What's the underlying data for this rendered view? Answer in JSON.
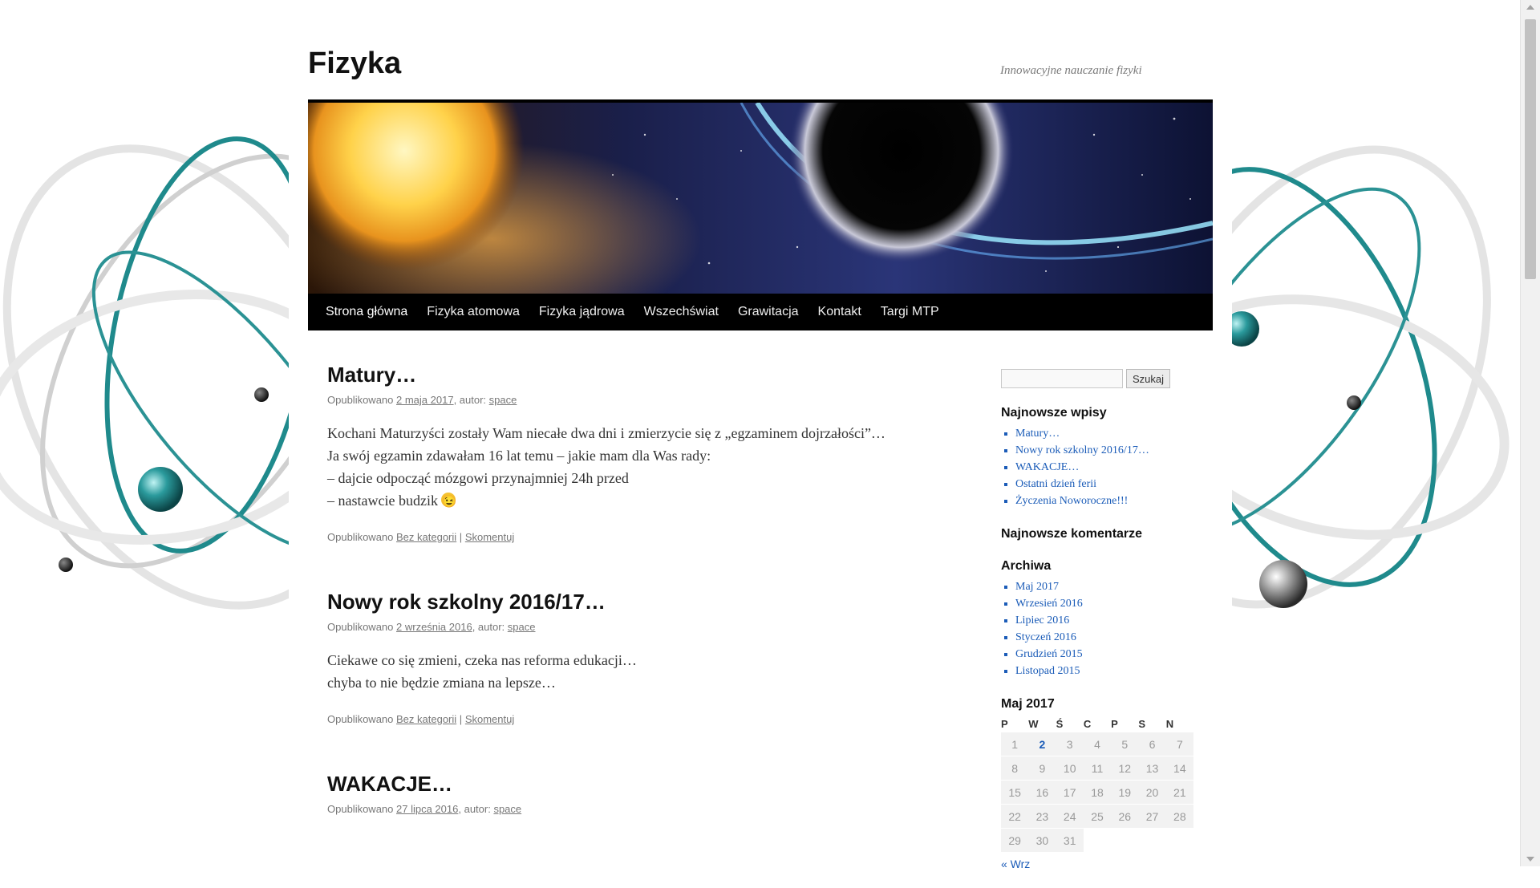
{
  "site": {
    "title": "Fizyka",
    "description": "Innowacyjne nauczanie fizyki"
  },
  "nav": {
    "items": [
      "Strona główna",
      "Fizyka atomowa",
      "Fizyka jądrowa",
      "Wszechświat",
      "Grawitacja",
      "Kontakt",
      "Targi MTP"
    ],
    "current": "Strona główna"
  },
  "posts": [
    {
      "title": "Matury…",
      "meta_prefix": "Opublikowano",
      "date": "2 maja 2017",
      "author_prefix": ", autor:",
      "author": "space",
      "body": [
        "Kochani Maturzyści zostały Wam niecałe dwa dni i zmierzycie się z „egzaminem dojrzałości”…",
        "Ja swój egzamin zdawałam 16 lat temu – jakie mam dla Was rady:",
        "– dajcie odpocząć mózgowi przynajmniej 24h przed",
        "– nastawcie budzik"
      ],
      "foot_prefix": "Opublikowano",
      "category": "Bez kategorii",
      "separator": "|",
      "comment": "Skomentuj"
    },
    {
      "title": "Nowy rok szkolny 2016/17…",
      "meta_prefix": "Opublikowano",
      "date": "2 września 2016",
      "author_prefix": ", autor:",
      "author": "space",
      "body": [
        "Ciekawe co się zmieni, czeka nas reforma edukacji…",
        "chyba to nie będzie zmiana na lepsze…"
      ],
      "foot_prefix": "Opublikowano",
      "category": "Bez kategorii",
      "separator": "|",
      "comment": "Skomentuj"
    },
    {
      "title": "WAKACJE…",
      "meta_prefix": "Opublikowano",
      "date": "27 lipca 2016",
      "author_prefix": ", autor:",
      "author": "space"
    }
  ],
  "sidebar": {
    "search_button": "Szukaj",
    "search_value": "",
    "recent_posts_title": "Najnowsze wpisy",
    "recent_posts": [
      "Matury…",
      "Nowy rok szkolny 2016/17…",
      "WAKACJE…",
      "Ostatni dzień ferii",
      "Życzenia Noworoczne!!!"
    ],
    "recent_comments_title": "Najnowsze komentarze",
    "archives_title": "Archiwa",
    "archives": [
      "Maj 2017",
      "Wrzesień 2016",
      "Lipiec 2016",
      "Styczeń 2016",
      "Grudzień 2015",
      "Listopad 2015"
    ],
    "calendar": {
      "caption": "Maj 2017",
      "weekdays": [
        "P",
        "W",
        "Ś",
        "C",
        "P",
        "S",
        "N"
      ],
      "weeks": [
        [
          "1",
          "2",
          "3",
          "4",
          "5",
          "6",
          "7"
        ],
        [
          "8",
          "9",
          "10",
          "11",
          "12",
          "13",
          "14"
        ],
        [
          "15",
          "16",
          "17",
          "18",
          "19",
          "20",
          "21"
        ],
        [
          "22",
          "23",
          "24",
          "25",
          "26",
          "27",
          "28"
        ],
        [
          "29",
          "30",
          "31",
          "",
          "",
          "",
          ""
        ]
      ],
      "linked_days": [
        "2"
      ],
      "prev": "« Wrz"
    }
  },
  "colors": {
    "link": "#1b5cb8",
    "nav_bg": "#000000",
    "accent_teal": "#1f8a8c"
  }
}
